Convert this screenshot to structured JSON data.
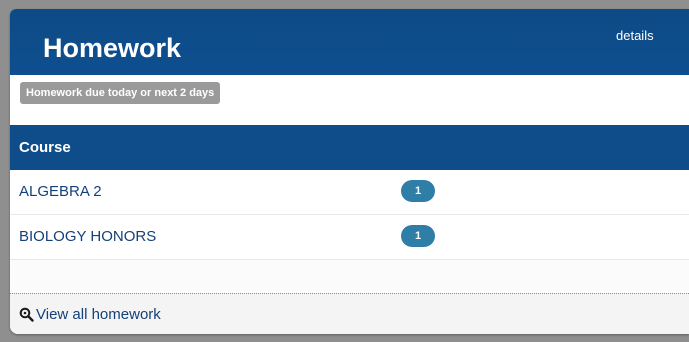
{
  "header": {
    "title": "Homework",
    "details_link": "details"
  },
  "subheader": {
    "badge": "Homework due today or next 2 days"
  },
  "table": {
    "column_header": "Course",
    "rows": [
      {
        "course": "ALGEBRA 2",
        "count": "1"
      },
      {
        "course": "BIOLOGY HONORS",
        "count": "1"
      }
    ]
  },
  "footer": {
    "link": "View all homework",
    "icon": "magnifier-icon"
  },
  "colors": {
    "header_bg": "#0f4c8a",
    "badge_bg": "#2f7ea8",
    "link": "#14407a"
  }
}
